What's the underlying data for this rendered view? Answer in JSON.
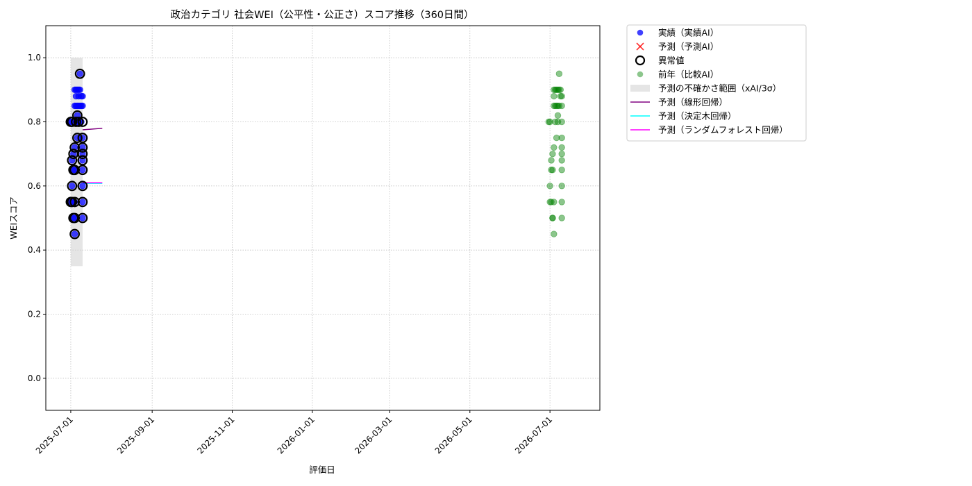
{
  "chart_data": {
    "type": "scatter",
    "title": "政治カテゴリ 社会WEI（公平性・公正さ）スコア推移（360日間）",
    "xlabel": "評価日",
    "ylabel": "WEIスコア",
    "x_range": [
      "2025-06-12",
      "2026-08-08"
    ],
    "ylim": [
      -0.1,
      1.1
    ],
    "x_ticks": [
      "2025-07-01",
      "2025-09-01",
      "2025-11-01",
      "2026-01-01",
      "2026-03-01",
      "2026-05-01",
      "2026-07-01"
    ],
    "y_ticks": [
      0.0,
      0.2,
      0.4,
      0.6,
      0.8,
      1.0
    ],
    "y_tick_labels": [
      "0.0",
      "0.2",
      "0.4",
      "0.6",
      "0.8",
      "1.0"
    ],
    "grid": true,
    "legend_position": "outside-right-top",
    "colors": {
      "actual": "#0000ff",
      "predicted": "#ff0000",
      "anomaly": "#000000",
      "previous_year": "#008000",
      "uncertainty": "#d3d3d3",
      "linear": "#800080",
      "tree": "#00ffff",
      "forest": "#ff00ff"
    },
    "legend": [
      {
        "key": "actual",
        "label": "実績（実績AI）",
        "marker": "dot"
      },
      {
        "key": "predicted",
        "label": "予測（予測AI）",
        "marker": "cross"
      },
      {
        "key": "anomaly",
        "label": "異常値",
        "marker": "ring"
      },
      {
        "key": "previous_year",
        "label": "前年（比較AI）",
        "marker": "dot-faded"
      },
      {
        "key": "uncertainty",
        "label": "予測の不確かさ範囲（xAI/3σ）",
        "marker": "band"
      },
      {
        "key": "linear",
        "label": "予測（線形回帰）",
        "marker": "line"
      },
      {
        "key": "tree",
        "label": "予測（決定木回帰）",
        "marker": "line"
      },
      {
        "key": "forest",
        "label": "予測（ランダムフォレスト回帰）",
        "marker": "line"
      }
    ],
    "uncertainty_band": {
      "x": [
        "2025-07-01",
        "2025-07-10"
      ],
      "y": [
        0.35,
        1.0
      ]
    },
    "series": [
      {
        "name": "実績（実績AI）",
        "points": [
          [
            "2025-07-01",
            0.55
          ],
          [
            "2025-07-01",
            0.8
          ],
          [
            "2025-07-02",
            0.68
          ],
          [
            "2025-07-02",
            0.6
          ],
          [
            "2025-07-02",
            0.55
          ],
          [
            "2025-07-02",
            0.8
          ],
          [
            "2025-07-03",
            0.65
          ],
          [
            "2025-07-03",
            0.5
          ],
          [
            "2025-07-03",
            0.7
          ],
          [
            "2025-07-04",
            0.65
          ],
          [
            "2025-07-04",
            0.5
          ],
          [
            "2025-07-04",
            0.55
          ],
          [
            "2025-07-04",
            0.45
          ],
          [
            "2025-07-04",
            0.72
          ],
          [
            "2025-07-04",
            0.9
          ],
          [
            "2025-07-04",
            0.85
          ],
          [
            "2025-07-05",
            0.9
          ],
          [
            "2025-07-05",
            0.88
          ],
          [
            "2025-07-05",
            0.85
          ],
          [
            "2025-07-06",
            0.8
          ],
          [
            "2025-07-06",
            0.9
          ],
          [
            "2025-07-06",
            0.85
          ],
          [
            "2025-07-06",
            0.82
          ],
          [
            "2025-07-06",
            0.75
          ],
          [
            "2025-07-07",
            0.88
          ],
          [
            "2025-07-07",
            0.85
          ],
          [
            "2025-07-07",
            0.8
          ],
          [
            "2025-07-07",
            0.9
          ],
          [
            "2025-07-08",
            0.95
          ],
          [
            "2025-07-08",
            0.9
          ],
          [
            "2025-07-08",
            0.85
          ],
          [
            "2025-07-09",
            0.88
          ],
          [
            "2025-07-09",
            0.85
          ],
          [
            "2025-07-09",
            0.8
          ],
          [
            "2025-07-10",
            0.75
          ],
          [
            "2025-07-10",
            0.72
          ],
          [
            "2025-07-10",
            0.7
          ],
          [
            "2025-07-10",
            0.68
          ],
          [
            "2025-07-10",
            0.65
          ],
          [
            "2025-07-10",
            0.6
          ],
          [
            "2025-07-10",
            0.55
          ],
          [
            "2025-07-10",
            0.5
          ],
          [
            "2025-07-10",
            0.85
          ],
          [
            "2025-07-10",
            0.88
          ]
        ]
      },
      {
        "name": "異常値",
        "points": [
          [
            "2025-07-01",
            0.55
          ],
          [
            "2025-07-01",
            0.8
          ],
          [
            "2025-07-02",
            0.68
          ],
          [
            "2025-07-02",
            0.6
          ],
          [
            "2025-07-02",
            0.55
          ],
          [
            "2025-07-02",
            0.8
          ],
          [
            "2025-07-03",
            0.65
          ],
          [
            "2025-07-03",
            0.5
          ],
          [
            "2025-07-03",
            0.7
          ],
          [
            "2025-07-04",
            0.65
          ],
          [
            "2025-07-04",
            0.5
          ],
          [
            "2025-07-04",
            0.55
          ],
          [
            "2025-07-04",
            0.45
          ],
          [
            "2025-07-04",
            0.72
          ],
          [
            "2025-07-05",
            0.8
          ],
          [
            "2025-07-06",
            0.82
          ],
          [
            "2025-07-06",
            0.75
          ],
          [
            "2025-07-07",
            0.8
          ],
          [
            "2025-07-08",
            0.95
          ],
          [
            "2025-07-10",
            0.8
          ],
          [
            "2025-07-10",
            0.75
          ],
          [
            "2025-07-10",
            0.72
          ],
          [
            "2025-07-10",
            0.7
          ],
          [
            "2025-07-10",
            0.68
          ],
          [
            "2025-07-10",
            0.65
          ],
          [
            "2025-07-10",
            0.6
          ],
          [
            "2025-07-10",
            0.55
          ],
          [
            "2025-07-10",
            0.5
          ]
        ]
      },
      {
        "name": "前年（比較AI）",
        "points": [
          [
            "2026-06-30",
            0.8
          ],
          [
            "2026-07-01",
            0.55
          ],
          [
            "2026-07-01",
            0.8
          ],
          [
            "2026-07-01",
            0.6
          ],
          [
            "2026-07-02",
            0.55
          ],
          [
            "2026-07-02",
            0.68
          ],
          [
            "2026-07-02",
            0.65
          ],
          [
            "2026-07-03",
            0.5
          ],
          [
            "2026-07-03",
            0.7
          ],
          [
            "2026-07-03",
            0.65
          ],
          [
            "2026-07-03",
            0.5
          ],
          [
            "2026-07-04",
            0.55
          ],
          [
            "2026-07-04",
            0.45
          ],
          [
            "2026-07-04",
            0.72
          ],
          [
            "2026-07-04",
            0.9
          ],
          [
            "2026-07-04",
            0.85
          ],
          [
            "2026-07-04",
            0.88
          ],
          [
            "2026-07-05",
            0.9
          ],
          [
            "2026-07-05",
            0.85
          ],
          [
            "2026-07-05",
            0.8
          ],
          [
            "2026-07-06",
            0.9
          ],
          [
            "2026-07-06",
            0.85
          ],
          [
            "2026-07-06",
            0.75
          ],
          [
            "2026-07-07",
            0.82
          ],
          [
            "2026-07-07",
            0.9
          ],
          [
            "2026-07-07",
            0.85
          ],
          [
            "2026-07-07",
            0.8
          ],
          [
            "2026-07-08",
            0.95
          ],
          [
            "2026-07-08",
            0.9
          ],
          [
            "2026-07-08",
            0.85
          ],
          [
            "2026-07-09",
            0.88
          ],
          [
            "2026-07-09",
            0.9
          ],
          [
            "2026-07-10",
            0.88
          ],
          [
            "2026-07-10",
            0.85
          ],
          [
            "2026-07-10",
            0.8
          ],
          [
            "2026-07-10",
            0.75
          ],
          [
            "2026-07-10",
            0.72
          ],
          [
            "2026-07-10",
            0.7
          ],
          [
            "2026-07-10",
            0.68
          ],
          [
            "2026-07-10",
            0.65
          ],
          [
            "2026-07-10",
            0.6
          ],
          [
            "2026-07-10",
            0.55
          ],
          [
            "2026-07-10",
            0.5
          ]
        ]
      },
      {
        "name": "予測（線形回帰）",
        "points": [
          [
            "2025-07-10",
            0.775
          ],
          [
            "2025-07-25",
            0.78
          ]
        ]
      },
      {
        "name": "予測（決定木回帰）",
        "points": [
          [
            "2025-07-10",
            0.608
          ],
          [
            "2025-07-25",
            0.608
          ]
        ]
      },
      {
        "name": "予測（ランダムフォレスト回帰）",
        "points": [
          [
            "2025-07-10",
            0.61
          ],
          [
            "2025-07-25",
            0.61
          ]
        ]
      }
    ]
  }
}
